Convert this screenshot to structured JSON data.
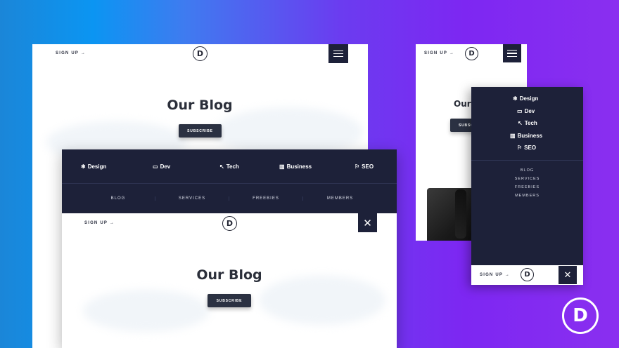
{
  "desktop": {
    "signup": "SIGN UP →",
    "logo": "D",
    "title": "Our Blog",
    "subscribe": "SUBSCRIBE"
  },
  "overlay": {
    "categories": [
      {
        "icon": "❄",
        "icon_name": "design-icon",
        "label": "Design"
      },
      {
        "icon": "▭",
        "icon_name": "monitor-icon",
        "label": "Dev"
      },
      {
        "icon": "↖",
        "icon_name": "cursor-icon",
        "label": "Tech"
      },
      {
        "icon": "▥",
        "icon_name": "chart-icon",
        "label": "Business"
      },
      {
        "icon": "⚐",
        "icon_name": "seo-icon",
        "label": "SEO"
      }
    ],
    "links": [
      "BLOG",
      "SERVICES",
      "FREEBIES",
      "MEMBERS"
    ],
    "signup": "SIGN UP →",
    "logo": "D",
    "title": "Our Blog",
    "subscribe": "SUBSCRIBE",
    "close": "✕"
  },
  "mobile": {
    "signup": "SIGN UP →",
    "logo": "D",
    "title": "Our Blog",
    "subscribe": "SUBSCRIBE",
    "menu_categories": [
      {
        "icon": "❄",
        "label": "Design"
      },
      {
        "icon": "▭",
        "label": "Dev"
      },
      {
        "icon": "↖",
        "label": "Tech"
      },
      {
        "icon": "▥",
        "label": "Business"
      },
      {
        "icon": "⚐",
        "label": "SEO"
      }
    ],
    "menu_links": [
      "BLOG",
      "SERVICES",
      "FREEBIES",
      "MEMBERS"
    ],
    "menu_signup": "SIGN UP →",
    "close": "✕"
  },
  "brand": {
    "logo": "D",
    "navy": "#1d2139",
    "gradient_start": "#0b95f2",
    "gradient_end": "#8a2ff0"
  }
}
